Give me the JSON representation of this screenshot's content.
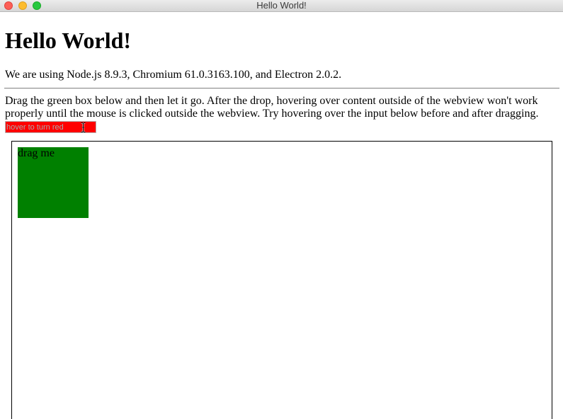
{
  "window": {
    "title": "Hello World!"
  },
  "page": {
    "heading": "Hello World!",
    "versions_text": "We are using Node.js 8.9.3, Chromium 61.0.3163.100, and Electron 2.0.2.",
    "instructions": "Drag the green box below and then let it go. After the drop, hovering over content outside of the webview won't work properly until the mouse is clicked outside the webview. Try hovering over the input below before and after dragging.",
    "hover_input": {
      "value": "",
      "placeholder": "hover to turn red",
      "background": "#ff0000"
    }
  },
  "webview": {
    "drag_box": {
      "label": "drag me",
      "color": "#008000"
    }
  },
  "icons": {
    "cursor": "i-beam-cursor-icon"
  },
  "colors": {
    "close": "#fc5f57",
    "minimize": "#fdbc2e",
    "zoom": "#28c840"
  }
}
